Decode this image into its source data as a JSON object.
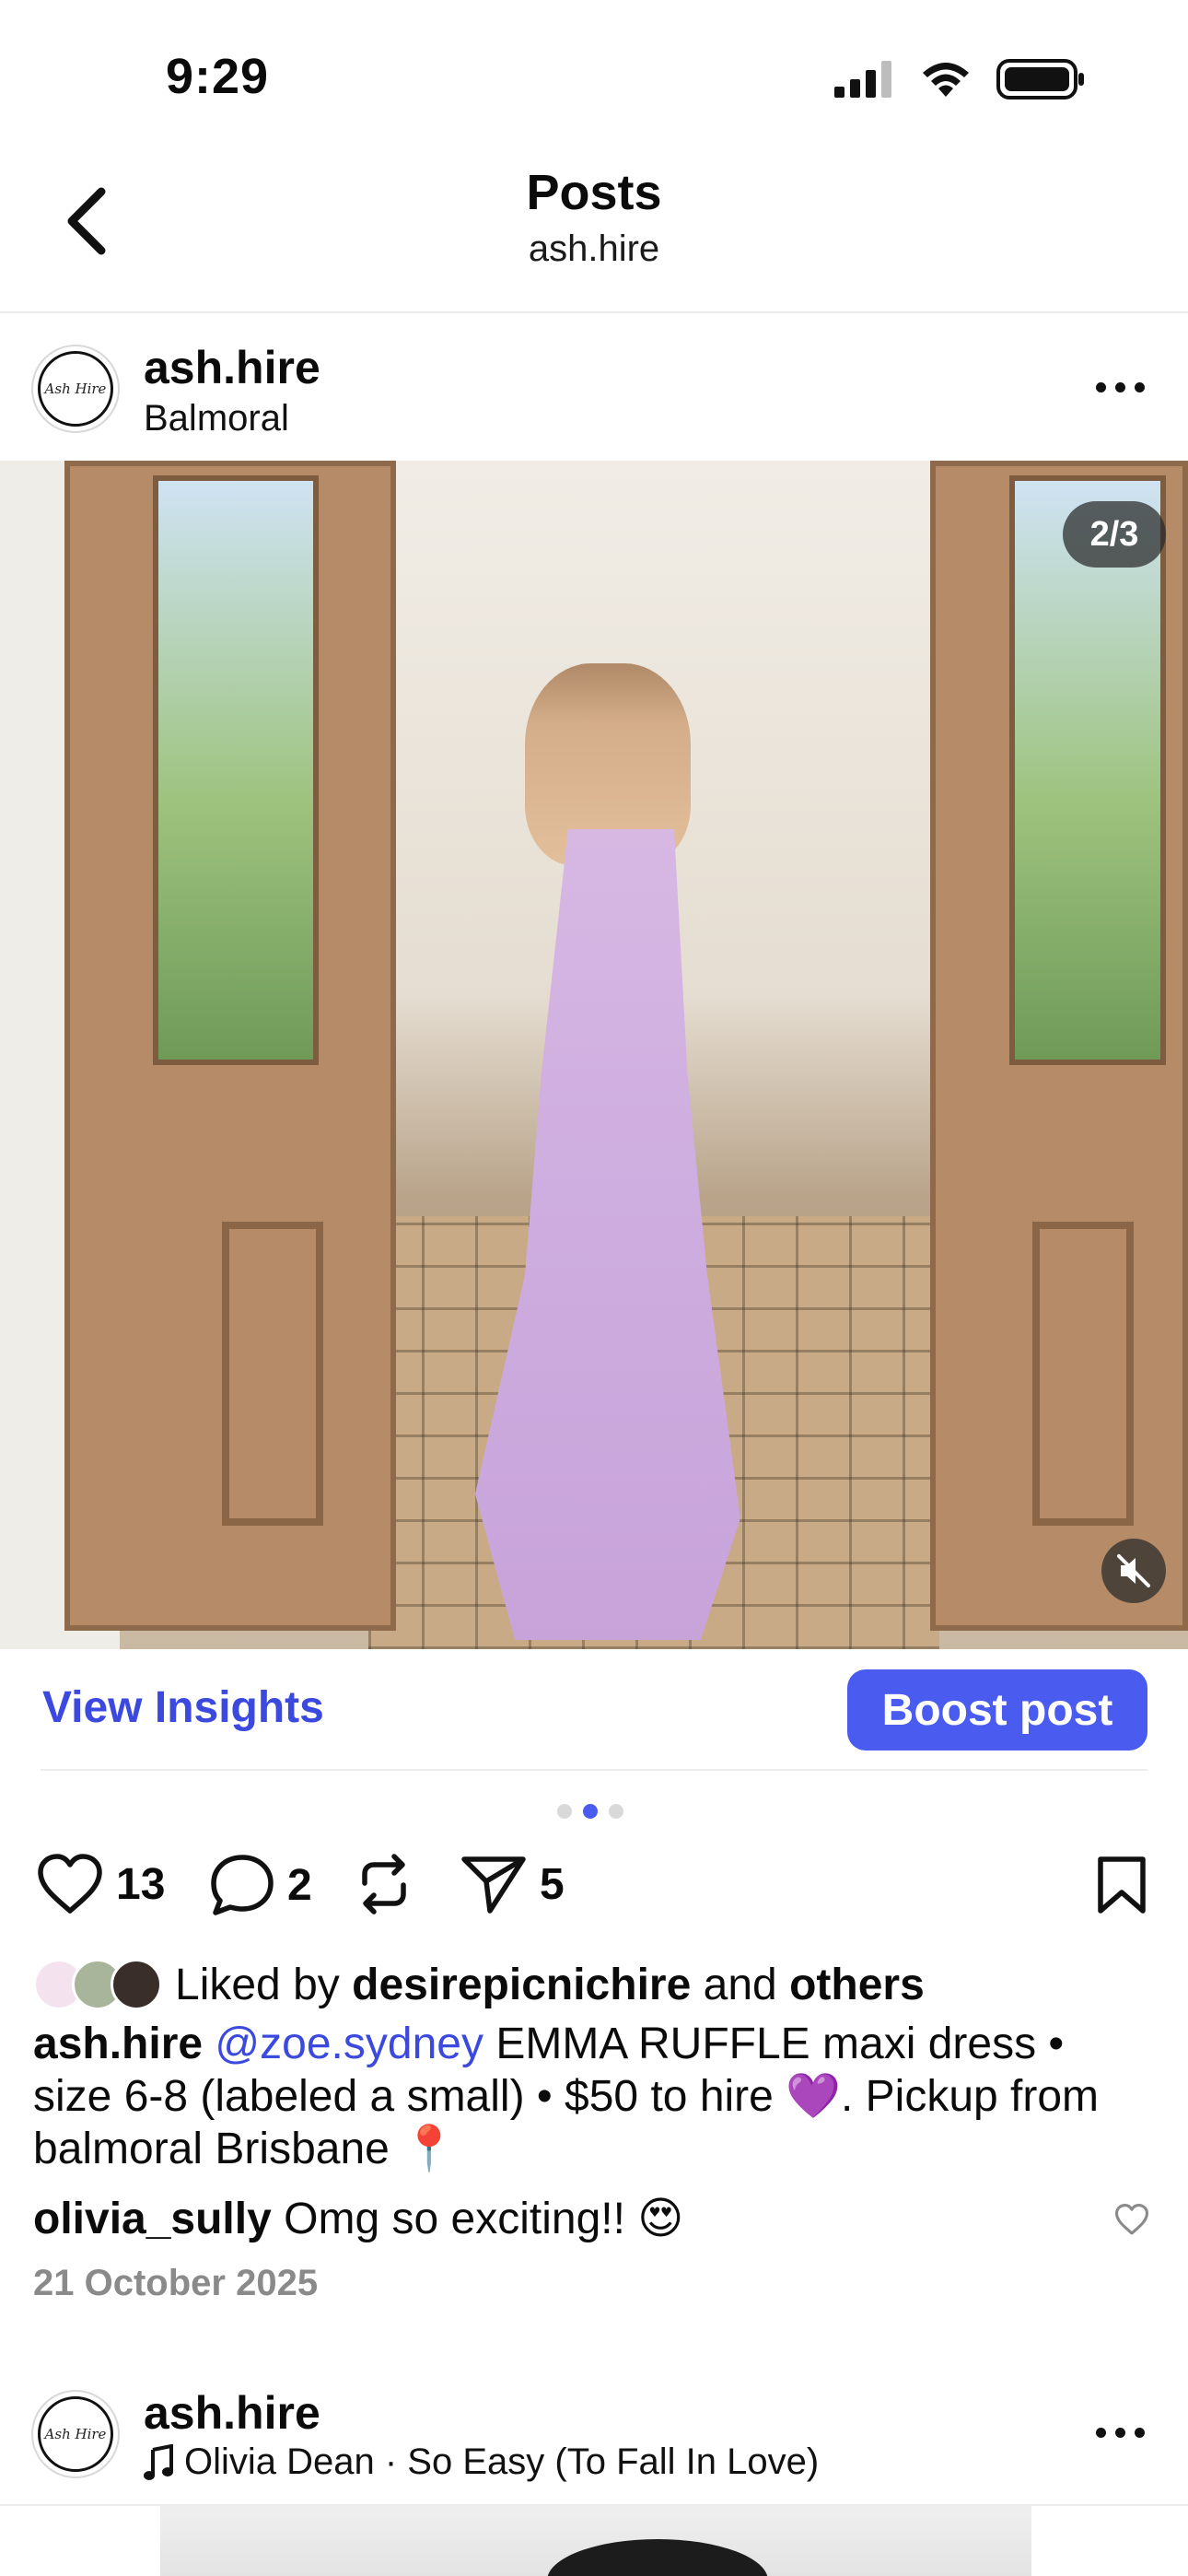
{
  "status_bar": {
    "time": "9:29"
  },
  "nav": {
    "title": "Posts",
    "subtitle": "ash.hire"
  },
  "post": {
    "avatar_text": "Ash Hire",
    "username": "ash.hire",
    "location": "Balmoral",
    "media_counter": "2/3",
    "view_insights": "View Insights",
    "boost": "Boost post",
    "carousel": {
      "count": 3,
      "active_index": 1
    },
    "likes": "13",
    "comments": "2",
    "shares": "5",
    "liked_by_prefix": "Liked by",
    "liked_by_user": "desirepicnichire",
    "liked_by_and": "and",
    "liked_by_others": "others",
    "caption_user": "ash.hire",
    "caption_mention": "@zoe.sydney",
    "caption_text": "EMMA RUFFLE maxi dress • size 6-8 (labeled a small) • $50 to hire 💜. Pickup from balmoral Brisbane 📍",
    "comment_user": "olivia_sully",
    "comment_text": "Omg so exciting!! 😍",
    "date": "21 October 2025"
  },
  "next_post": {
    "avatar_text": "Ash Hire",
    "username": "ash.hire",
    "audio": "Olivia Dean · So Easy (To Fall In Love)"
  },
  "colors": {
    "accent": "#4a5bf0",
    "link": "#3b49df",
    "muted": "#8a8a8a"
  }
}
